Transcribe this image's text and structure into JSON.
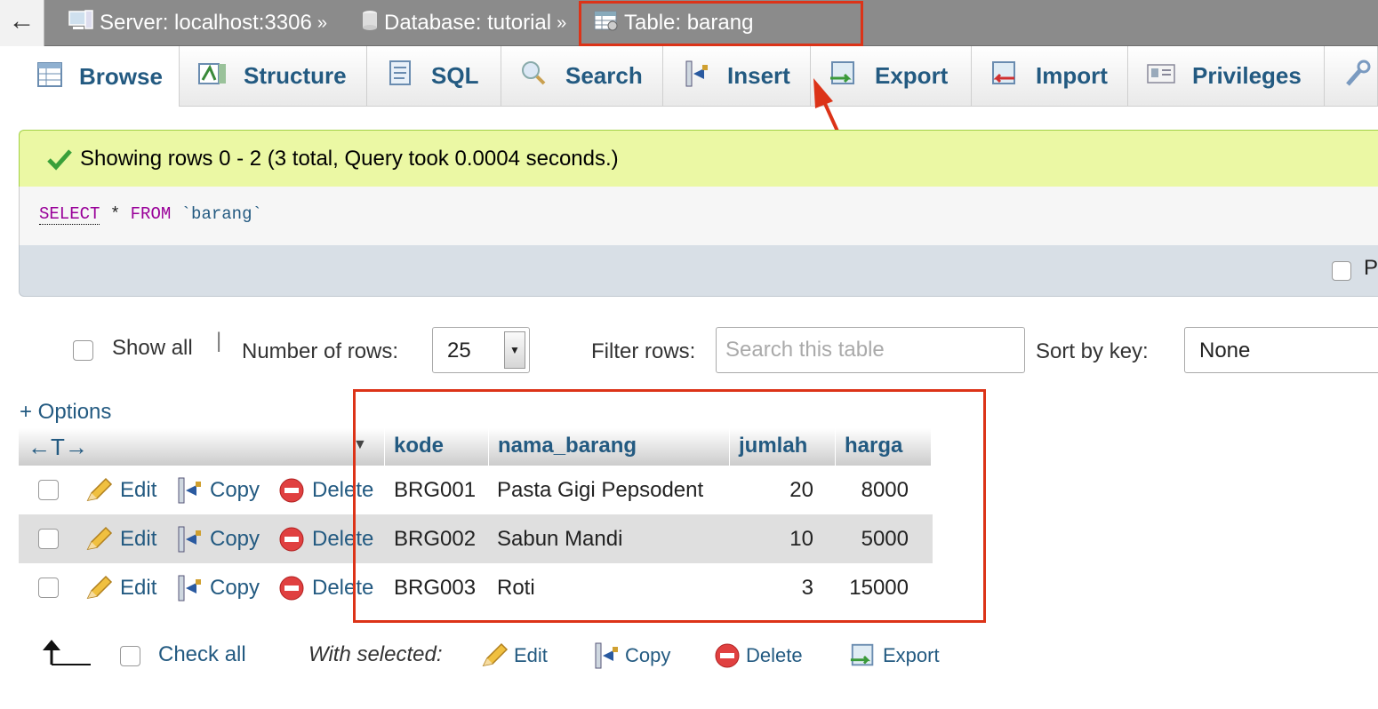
{
  "breadcrumb": {
    "back": "←",
    "server": "Server: localhost:3306",
    "database": "Database: tutorial",
    "table": "Table: barang",
    "separator": "»"
  },
  "tabs": [
    {
      "label": "Browse",
      "icon": "browse-icon"
    },
    {
      "label": "Structure",
      "icon": "structure-icon"
    },
    {
      "label": "SQL",
      "icon": "sql-icon"
    },
    {
      "label": "Search",
      "icon": "search-icon"
    },
    {
      "label": "Insert",
      "icon": "insert-icon"
    },
    {
      "label": "Export",
      "icon": "export-icon"
    },
    {
      "label": "Import",
      "icon": "import-icon"
    },
    {
      "label": "Privileges",
      "icon": "privileges-icon"
    }
  ],
  "notice": {
    "text": "Showing rows 0 - 2 (3 total, Query took 0.0004 seconds.)"
  },
  "query": {
    "select": "SELECT",
    "star": " * ",
    "from": "FROM",
    "table": " `barang`"
  },
  "profiling": {
    "label": "P"
  },
  "controls": {
    "show_all": "Show all",
    "divider": "|",
    "num_rows_label": "Number of rows:",
    "num_rows_value": "25",
    "filter_label": "Filter rows:",
    "filter_placeholder": "Search this table",
    "sort_label": "Sort by key:",
    "sort_value": "None"
  },
  "options_link": "+ Options",
  "table": {
    "arrows": "←T→",
    "headers": [
      "kode",
      "nama_barang",
      "jumlah",
      "harga"
    ],
    "action_labels": {
      "edit": "Edit",
      "copy": "Copy",
      "delete": "Delete"
    },
    "rows": [
      {
        "kode": "BRG001",
        "nama_barang": "Pasta Gigi Pepsodent",
        "jumlah": "20",
        "harga": "8000"
      },
      {
        "kode": "BRG002",
        "nama_barang": "Sabun Mandi",
        "jumlah": "10",
        "harga": "5000"
      },
      {
        "kode": "BRG003",
        "nama_barang": "Roti",
        "jumlah": "3",
        "harga": "15000"
      }
    ]
  },
  "bottom": {
    "check_all": "Check all",
    "with_selected": "With selected:",
    "edit": "Edit",
    "copy": "Copy",
    "delete": "Delete",
    "export": "Export"
  },
  "colors": {
    "link": "#235a81",
    "annotation": "#dc3318",
    "notice_bg": "#ebf8a4",
    "topbar": "#8b8b8b"
  }
}
